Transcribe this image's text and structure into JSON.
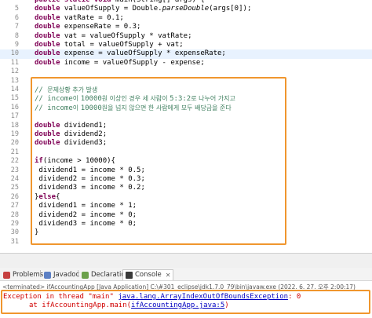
{
  "editor": {
    "lines": [
      {
        "n": "",
        "segs": [
          [
            "kw",
            "public static void"
          ],
          [
            "",
            " main(String[] args) {"
          ]
        ]
      },
      {
        "n": "5",
        "segs": [
          [
            "kw",
            "double"
          ],
          [
            "",
            " valueOfSupply = Double."
          ],
          [
            "it",
            "parseDouble"
          ],
          [
            "",
            "(args[0]);"
          ]
        ]
      },
      {
        "n": "6",
        "segs": [
          [
            "kw",
            "double"
          ],
          [
            "",
            " vatRate = 0.1;"
          ]
        ]
      },
      {
        "n": "7",
        "segs": [
          [
            "kw",
            "double"
          ],
          [
            "",
            " expenseRate = 0.3;"
          ]
        ]
      },
      {
        "n": "8",
        "segs": [
          [
            "kw",
            "double"
          ],
          [
            "",
            " vat = valueOfSupply * vatRate;"
          ]
        ]
      },
      {
        "n": "9",
        "segs": [
          [
            "kw",
            "double"
          ],
          [
            "",
            " total = valueOfSupply + vat;"
          ]
        ]
      },
      {
        "n": "10",
        "hl": true,
        "segs": [
          [
            "kw",
            "double"
          ],
          [
            "",
            " expense = valueOfSupply * expenseRate;"
          ]
        ]
      },
      {
        "n": "11",
        "segs": [
          [
            "kw",
            "double"
          ],
          [
            "",
            " income = valueOfSupply - expense;"
          ]
        ]
      },
      {
        "n": "12",
        "segs": []
      },
      {
        "n": "13",
        "segs": []
      },
      {
        "n": "14",
        "segs": [
          [
            "cm",
            "// "
          ],
          [
            "cmk",
            "문제상황 추가 발생"
          ]
        ]
      },
      {
        "n": "15",
        "segs": [
          [
            "cm",
            "// income"
          ],
          [
            "cmk",
            "이 "
          ],
          [
            "cm",
            "10000"
          ],
          [
            "cmk",
            "원 이상인 경우 세 사람이 "
          ],
          [
            "cm",
            "5:3:2"
          ],
          [
            "cmk",
            "로 나누어 가지고"
          ]
        ]
      },
      {
        "n": "16",
        "segs": [
          [
            "cm",
            "// income"
          ],
          [
            "cmk",
            "이 "
          ],
          [
            "cm",
            "10000"
          ],
          [
            "cmk",
            "원을 넘지 않으면 한 사람에게 모두 배당금을 준다"
          ]
        ]
      },
      {
        "n": "17",
        "segs": []
      },
      {
        "n": "18",
        "segs": [
          [
            "kw",
            "double"
          ],
          [
            "",
            " dividend1;"
          ]
        ]
      },
      {
        "n": "19",
        "segs": [
          [
            "kw",
            "double"
          ],
          [
            "",
            " dividend2;"
          ]
        ]
      },
      {
        "n": "20",
        "segs": [
          [
            "kw",
            "double"
          ],
          [
            "",
            " dividend3;"
          ]
        ]
      },
      {
        "n": "21",
        "segs": []
      },
      {
        "n": "22",
        "segs": [
          [
            "kw",
            "if"
          ],
          [
            "",
            "(income > 10000){"
          ]
        ]
      },
      {
        "n": "23",
        "segs": [
          [
            "",
            " dividend1 = income * 0.5;"
          ]
        ]
      },
      {
        "n": "24",
        "segs": [
          [
            "",
            " dividend2 = income * 0.3;"
          ]
        ]
      },
      {
        "n": "25",
        "segs": [
          [
            "",
            " dividend3 = income * 0.2;"
          ]
        ]
      },
      {
        "n": "26",
        "segs": [
          [
            "",
            "}"
          ],
          [
            "kw",
            "else"
          ],
          [
            "",
            "{"
          ]
        ]
      },
      {
        "n": "27",
        "segs": [
          [
            "",
            " dividend1 = income * 1;"
          ]
        ]
      },
      {
        "n": "28",
        "segs": [
          [
            "",
            " dividend2 = income * 0;"
          ]
        ]
      },
      {
        "n": "29",
        "segs": [
          [
            "",
            " dividend3 = income * 0;"
          ]
        ]
      },
      {
        "n": "30",
        "segs": [
          [
            "",
            "}"
          ]
        ]
      },
      {
        "n": "31",
        "segs": []
      }
    ]
  },
  "tabs": {
    "problems": "Problems",
    "javadoc": "Javadoc",
    "declaration": "Declaration",
    "console": "Console"
  },
  "console": {
    "terminated": "<terminated> ifAccountingApp [Java Application] C:\\#301_eclipse\\jdk1.7.0_79\\bin\\javaw.exe (2022. 6. 27. 오후 2:00:17)",
    "exception_prefix": "Exception in thread \"main\" ",
    "exception_class": "java.lang.ArrayIndexOutOfBoundsException",
    "exception_suffix": ": 0",
    "at_prefix": "at ifAccountingApp.main(",
    "at_link": "ifAccountingApp.java:5",
    "at_suffix": ")"
  },
  "colors": {
    "keyword": "#7f0055",
    "comment": "#3f7f5f",
    "error": "#d00000",
    "link": "#0000c0",
    "highlight_box": "#f0962e"
  }
}
